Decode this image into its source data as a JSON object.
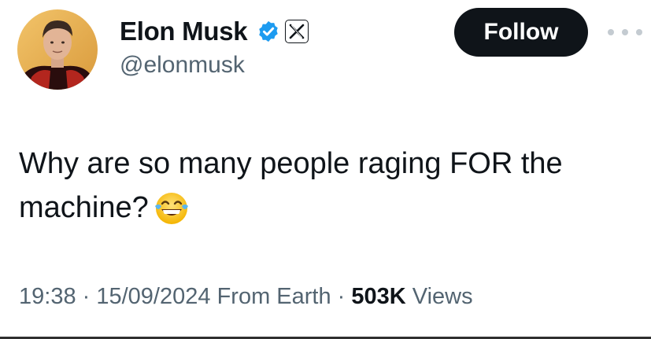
{
  "author": {
    "display_name": "Elon Musk",
    "handle": "@elonmusk",
    "verified_icon": "verified-badge-icon",
    "affiliation_icon": "x-logo-icon"
  },
  "actions": {
    "follow_label": "Follow",
    "more_icon": "more-horizontal-icon"
  },
  "tweet": {
    "text_line1": "Why are so many people raging FOR the",
    "text_line2": "machine?",
    "emoji": "face-with-tears-of-joy-icon"
  },
  "meta": {
    "time": "19:38",
    "sep1": " · ",
    "date": "15/09/2024",
    "source": " From Earth",
    "sep2": " · ",
    "views_count": "503K",
    "views_label": " Views"
  },
  "colors": {
    "text_primary": "#0f1419",
    "text_secondary": "#536471",
    "verified_blue": "#1d9bf0",
    "button_bg": "#0f1419"
  }
}
